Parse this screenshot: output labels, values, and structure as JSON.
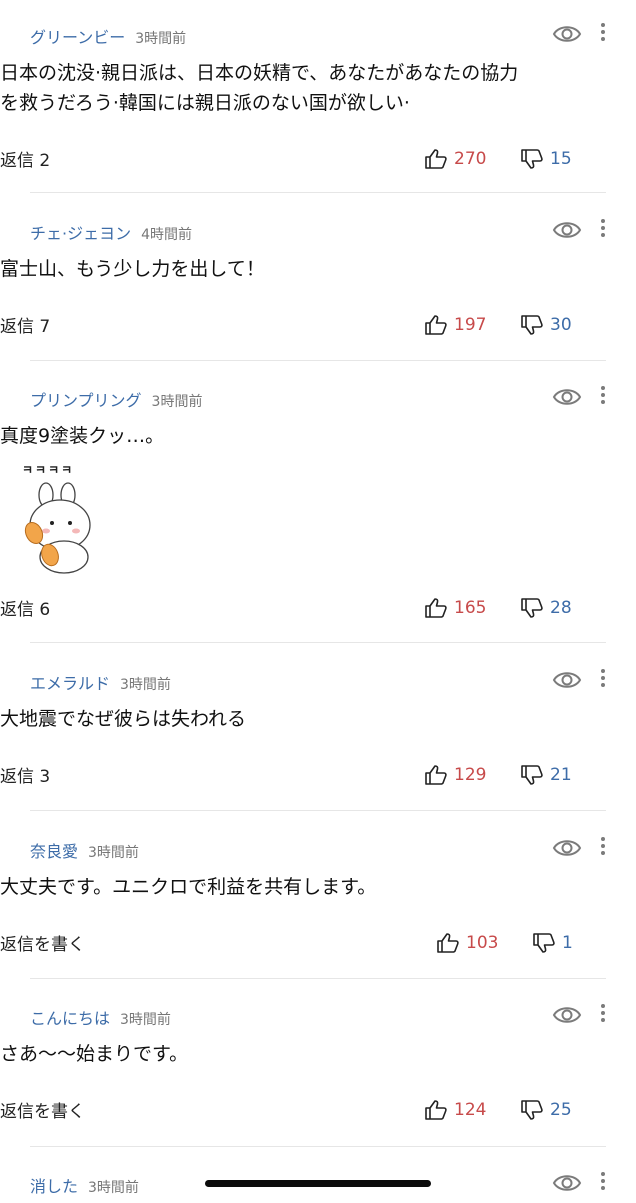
{
  "comments": [
    {
      "author": "グリーンビー",
      "time": "3時間前",
      "text_lines": [
        "日本の沈没·親日派は、日本の妖精で、あなたがあなたの協力",
        "を救うだろう·韓国には親日派のない国が欲しい·"
      ],
      "reply": "返信 2",
      "likes": "270",
      "dislikes": "15"
    },
    {
      "author": "チェ·ジェヨン",
      "time": "4時間前",
      "text_lines": [
        "富士山、もう少し力を出して！"
      ],
      "reply": "返信 7",
      "likes": "197",
      "dislikes": "30"
    },
    {
      "author": "プリンプリング",
      "time": "3時間前",
      "text_lines": [
        "真度9塗装クッ…。"
      ],
      "sticker_text": "ㅋㅋㅋㅋ",
      "reply": "返信 6",
      "likes": "165",
      "dislikes": "28"
    },
    {
      "author": "エメラルド",
      "time": "3時間前",
      "text_lines": [
        "大地震でなぜ彼らは失われる"
      ],
      "reply": "返信 3",
      "likes": "129",
      "dislikes": "21"
    },
    {
      "author": "奈良愛",
      "time": "3時間前",
      "text_lines": [
        "大丈夫です。ユニクロで利益を共有します。"
      ],
      "reply": "返信を書く",
      "likes": "103",
      "dislikes": "1"
    },
    {
      "author": "こんにちは",
      "time": "3時間前",
      "text_lines": [
        "さあ～～始まりです。"
      ],
      "reply": "返信を書く",
      "likes": "124",
      "dislikes": "25"
    },
    {
      "author": "消した",
      "time": "3時間前"
    }
  ],
  "icons": {
    "visibility": "eye-icon",
    "more": "more-vertical-icon",
    "like": "thumbs-up-icon",
    "dislike": "thumbs-down-icon"
  },
  "colors": {
    "author": "#3d6ca8",
    "like": "#c74a4a",
    "dislike": "#3d6ca8"
  }
}
